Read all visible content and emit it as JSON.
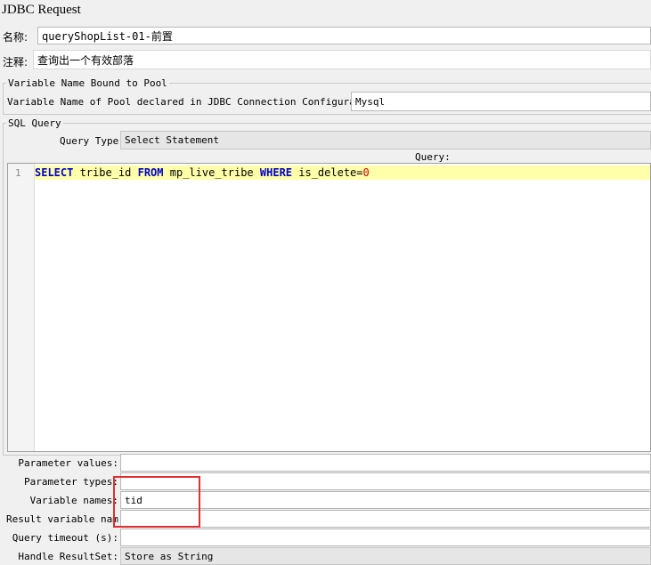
{
  "window": {
    "title": "JDBC Request"
  },
  "name_row": {
    "label": "名称:",
    "value": "queryShopList-01-前置"
  },
  "comment_row": {
    "label": "注释:",
    "value": "查询出一个有效部落"
  },
  "pool_group": {
    "legend": "Variable Name Bound to Pool",
    "label": "Variable Name of Pool declared in JDBC Connection Configuration:",
    "value": "Mysql"
  },
  "sql_group": {
    "legend": "SQL Query",
    "query_type_label": "Query Type:",
    "query_type_value": "Select Statement",
    "query_header": "Query:",
    "editor": {
      "line_number": "1",
      "tokens": [
        {
          "text": "SELECT",
          "kind": "keyword"
        },
        {
          "text": " tribe_id ",
          "kind": "plain"
        },
        {
          "text": "FROM",
          "kind": "keyword"
        },
        {
          "text": " mp_live_tribe ",
          "kind": "plain"
        },
        {
          "text": "WHERE",
          "kind": "keyword"
        },
        {
          "text": " is_delete=",
          "kind": "plain"
        },
        {
          "text": "0",
          "kind": "number"
        }
      ]
    }
  },
  "params": {
    "parameter_values": {
      "label": "Parameter values:",
      "value": ""
    },
    "parameter_types": {
      "label": "Parameter types:",
      "value": ""
    },
    "variable_names": {
      "label": "Variable names:",
      "value": "tid"
    },
    "result_variable_name": {
      "label": "Result variable name:",
      "value": ""
    },
    "query_timeout": {
      "label": "Query timeout (s):",
      "value": ""
    },
    "handle_resultset": {
      "label": "Handle ResultSet:",
      "value": "Store as String"
    }
  },
  "colors": {
    "highlight_box": "#e03030",
    "keyword": "#0000cc",
    "current_line": "#ffffaa"
  }
}
